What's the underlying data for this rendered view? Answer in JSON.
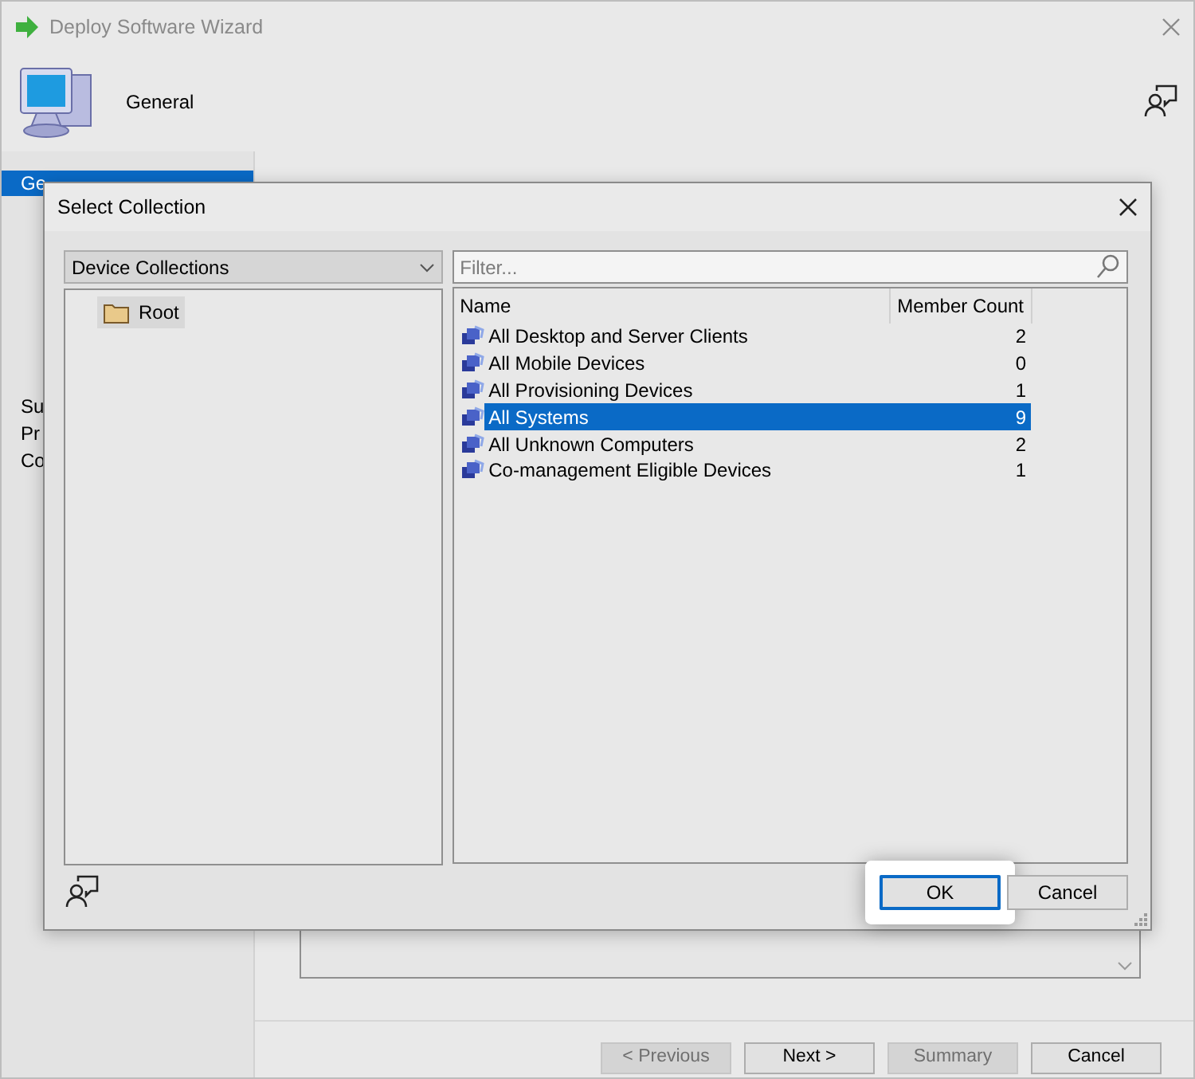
{
  "window": {
    "title": "Deploy Software Wizard"
  },
  "header": {
    "title": "General"
  },
  "sidebar": {
    "items": [
      {
        "label": "Ge",
        "selected": true
      },
      {
        "label": "Su",
        "selected": false
      },
      {
        "label": "Pr",
        "selected": false
      },
      {
        "label": "Co",
        "selected": false
      }
    ]
  },
  "dialog": {
    "title": "Select Collection",
    "collection_type": "Device Collections",
    "tree": [
      {
        "label": "Root",
        "selected": true
      }
    ],
    "filter": {
      "placeholder": "Filter..."
    },
    "table": {
      "columns": [
        "Name",
        "Member Count"
      ],
      "rows": [
        {
          "name": "All Desktop and Server Clients",
          "member_count": "2",
          "selected": false
        },
        {
          "name": "All Mobile Devices",
          "member_count": "0",
          "selected": false
        },
        {
          "name": "All Provisioning Devices",
          "member_count": "1",
          "selected": false
        },
        {
          "name": "All Systems",
          "member_count": "9",
          "selected": true
        },
        {
          "name": "All Unknown Computers",
          "member_count": "2",
          "selected": false
        },
        {
          "name": "Co-management Eligible Devices",
          "member_count": "1",
          "selected": false
        }
      ]
    },
    "buttons": [
      {
        "label": "OK",
        "default": true,
        "highlighted": true
      },
      {
        "label": "Cancel",
        "default": false,
        "highlighted": false
      }
    ]
  },
  "footer_buttons": [
    {
      "label": "< Previous",
      "disabled": true
    },
    {
      "label": "Next >",
      "disabled": false
    },
    {
      "label": "Summary",
      "disabled": true
    },
    {
      "label": "Cancel",
      "disabled": false
    }
  ]
}
